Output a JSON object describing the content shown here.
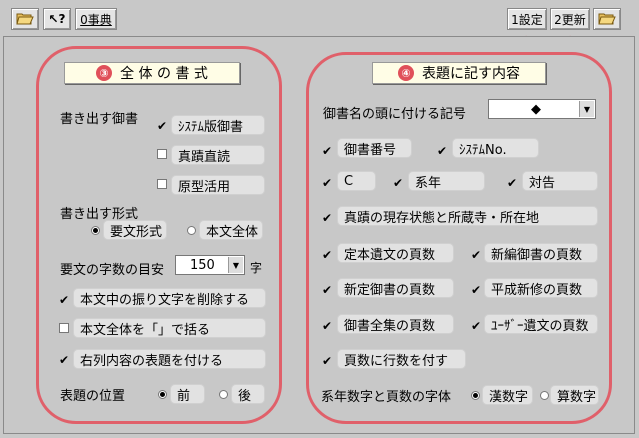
{
  "toolbar": {
    "left": {
      "dict_label": "0事典"
    },
    "right": {
      "settings_label": "1設定",
      "update_label": "2更新"
    },
    "markers": {
      "one": "①",
      "two": "②"
    }
  },
  "left_panel": {
    "number": "③",
    "title": "全 体 の 書 式",
    "output_book_label": "書き出す御書",
    "books": [
      {
        "label": "ｼｽﾃﾑ版御書",
        "checked": true
      },
      {
        "label": "真蹟直読",
        "checked": false
      },
      {
        "label": "原型活用",
        "checked": false
      }
    ],
    "output_format_label": "書き出す形式",
    "formats": [
      {
        "label": "要文形式",
        "selected": true
      },
      {
        "label": "本文全体",
        "selected": false
      }
    ],
    "char_count_label": "要文の字数の目安",
    "char_count_value": "150",
    "char_unit": "字",
    "options": [
      {
        "label": "本文中の振り文字を削除する",
        "checked": true
      },
      {
        "label": "本文全体を「」で括る",
        "checked": false
      },
      {
        "label": "右列内容の表題を付ける",
        "checked": true
      }
    ],
    "title_position_label": "表題の位置",
    "positions": [
      {
        "label": "前",
        "selected": true
      },
      {
        "label": "後",
        "selected": false
      }
    ]
  },
  "right_panel": {
    "number": "④",
    "title": "表題に記す内容",
    "symbol_label": "御書名の頭に付ける記号",
    "symbol_value": "◆",
    "items": {
      "gosho_number": {
        "label": "御書番号",
        "checked": true
      },
      "system_no": {
        "label": "ｼｽﾃﾑNo.",
        "checked": true
      },
      "c": {
        "label": "C",
        "checked": true
      },
      "keinen": {
        "label": "系年",
        "checked": true
      },
      "taikoku": {
        "label": "対告",
        "checked": true
      },
      "shinseki": {
        "label": "真蹟の現存状態と所蔵寺・所在地",
        "checked": true
      },
      "teihon": {
        "label": "定本遺文の頁数",
        "checked": true
      },
      "shinpen": {
        "label": "新編御書の頁数",
        "checked": true
      },
      "shintei": {
        "label": "新定御書の頁数",
        "checked": true
      },
      "heisei": {
        "label": "平成新修の頁数",
        "checked": true
      },
      "zenshu": {
        "label": "御書全集の頁数",
        "checked": true
      },
      "user": {
        "label": "ﾕｰｻﾞｰ遺文の頁数",
        "checked": true
      },
      "gyosu": {
        "label": "頁数に行数を付す",
        "checked": true
      }
    },
    "font_label": "系年数字と頁数の字体",
    "fonts": [
      {
        "label": "漢数字",
        "selected": true
      },
      {
        "label": "算数字",
        "selected": false
      }
    ]
  },
  "colors": {
    "accent": "#e0606a",
    "background": "#c8c8c8",
    "header_bg": "#fffde6"
  }
}
